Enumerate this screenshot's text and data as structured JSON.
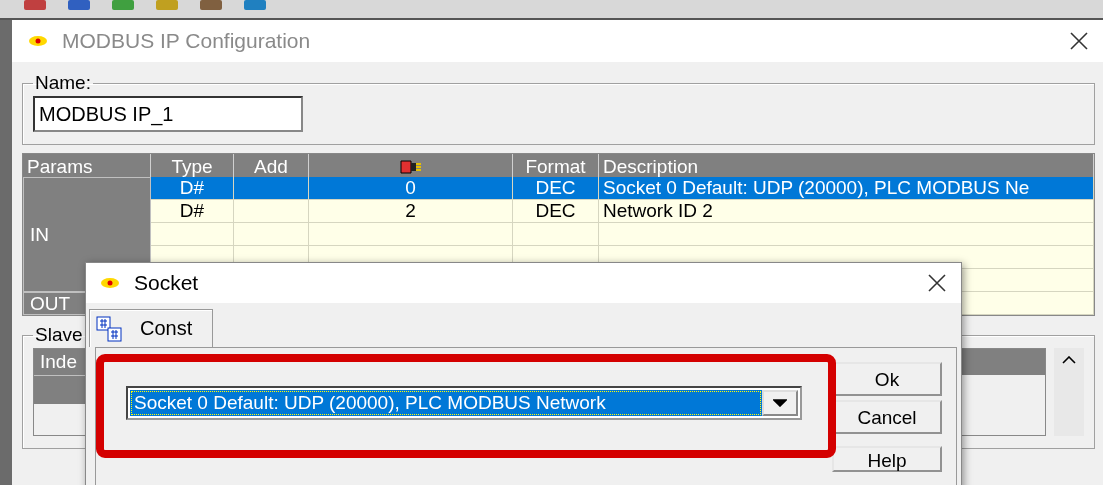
{
  "main_window": {
    "title": "MODBUS IP Configuration",
    "active": false
  },
  "name_group": {
    "label": "Name:",
    "value": "MODBUS IP_1"
  },
  "table": {
    "columns": [
      {
        "label": "Params"
      },
      {
        "label": "Type"
      },
      {
        "label": "Add"
      },
      {
        "kind": "icon"
      },
      {
        "label": "Format"
      },
      {
        "label": "Description"
      }
    ],
    "groups": [
      {
        "label": "IN",
        "rows": [
          {
            "type": "D#",
            "value": "0",
            "format": "DEC",
            "description": "Socket 0 Default: UDP (20000), PLC MODBUS Ne",
            "selected": true
          },
          {
            "type": "D#",
            "value": "2",
            "format": "DEC",
            "description": "Network ID 2",
            "selected": false
          }
        ]
      },
      {
        "label": "OUT"
      }
    ]
  },
  "slave_group": {
    "label": "Slave",
    "columns": [
      "Inde"
    ]
  },
  "dialog": {
    "title": "Socket",
    "active": true,
    "tabs": [
      {
        "label": "Const",
        "selected": true
      }
    ],
    "combo": {
      "value": "Socket 0 Default: UDP (20000), PLC MODBUS Network"
    },
    "buttons": [
      "Ok",
      "Cancel",
      "Help"
    ]
  }
}
